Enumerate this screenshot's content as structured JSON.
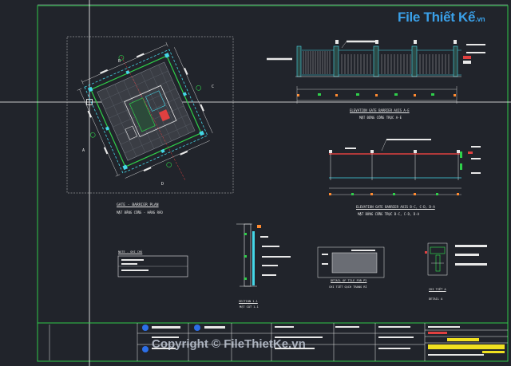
{
  "watermark": {
    "logo_text": "File Thiết Kế",
    "logo_suffix": ".vn",
    "copyright": "Copyright © FileThietKe.vn"
  },
  "drawing": {
    "plan_title": "GATE - BARRIER PLAN",
    "plan_subtitle": "MẶT BẰNG CỔNG - HÀNG RÀO",
    "elev1_title": "ELEVATION GATE BARRIER AXIS A-E",
    "elev1_subtitle": "MẶT ĐỨNG CỔNG TRỤC A-E",
    "elev2_title": "ELEVATION GATE BARRIER AXIS B-C, C-D, D-A",
    "elev2_subtitle": "MẶT ĐỨNG CỔNG TRỤC B-C, C-D, D-A",
    "section_title": "SECTION 1-1",
    "section_subtitle": "MẶT CẮT 1-1",
    "detail_title": "DETAIL OF TILE FOR P2",
    "detail_subtitle": "CHI TIẾT GẠCH TRANG RÍ",
    "detail_a_title": "CHI TIẾT A",
    "detail_a_subtitle": "DETAIL A",
    "note_title": "NOTE - GHI CHÚ",
    "point_labels": [
      "A",
      "B",
      "C",
      "D"
    ]
  },
  "colors": {
    "background": "#21242b",
    "linework": "#e8e8e8",
    "cyan": "#45d7e8",
    "green": "#2fd04a",
    "red": "#e04040",
    "orange": "#ff8a30",
    "yellow": "#f0e020",
    "frame_green": "#2ec84a",
    "watermark_blue": "#3aa0e8"
  }
}
